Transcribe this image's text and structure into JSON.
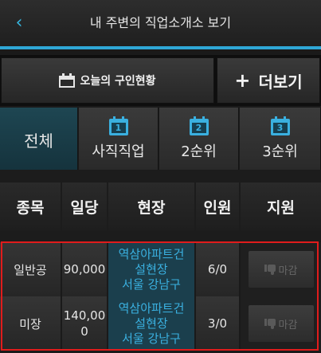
{
  "header": {
    "back_icon": "chevron-left-icon",
    "title": "내 주변의 직업소개소 보기",
    "accent": "#2fa7d6"
  },
  "toolbar": {
    "today_label": "오늘의 구인현황",
    "more_label": "더보기",
    "plus_symbol": "+"
  },
  "tabs": [
    {
      "label": "전체",
      "active": true
    },
    {
      "label": "사직직업",
      "day": "1"
    },
    {
      "label": "2순위",
      "day": "2"
    },
    {
      "label": "3순위",
      "day": "3"
    }
  ],
  "table": {
    "headers": [
      "종목",
      "일당",
      "현장",
      "인원",
      "지원"
    ],
    "rows": [
      {
        "type": "일반공",
        "pay": "90,000",
        "site_line1": "역삼아파트건",
        "site_line2": "설현장",
        "site_line3": "서울 강남구",
        "count": "6/0",
        "apply": "마감"
      },
      {
        "type": "미장",
        "pay_line1": "140,00",
        "pay_line2": "0",
        "site_line1": "역삼아파트건",
        "site_line2": "설현장",
        "site_line3": "서울 강남구",
        "count": "3/0",
        "apply": "마감"
      }
    ]
  }
}
